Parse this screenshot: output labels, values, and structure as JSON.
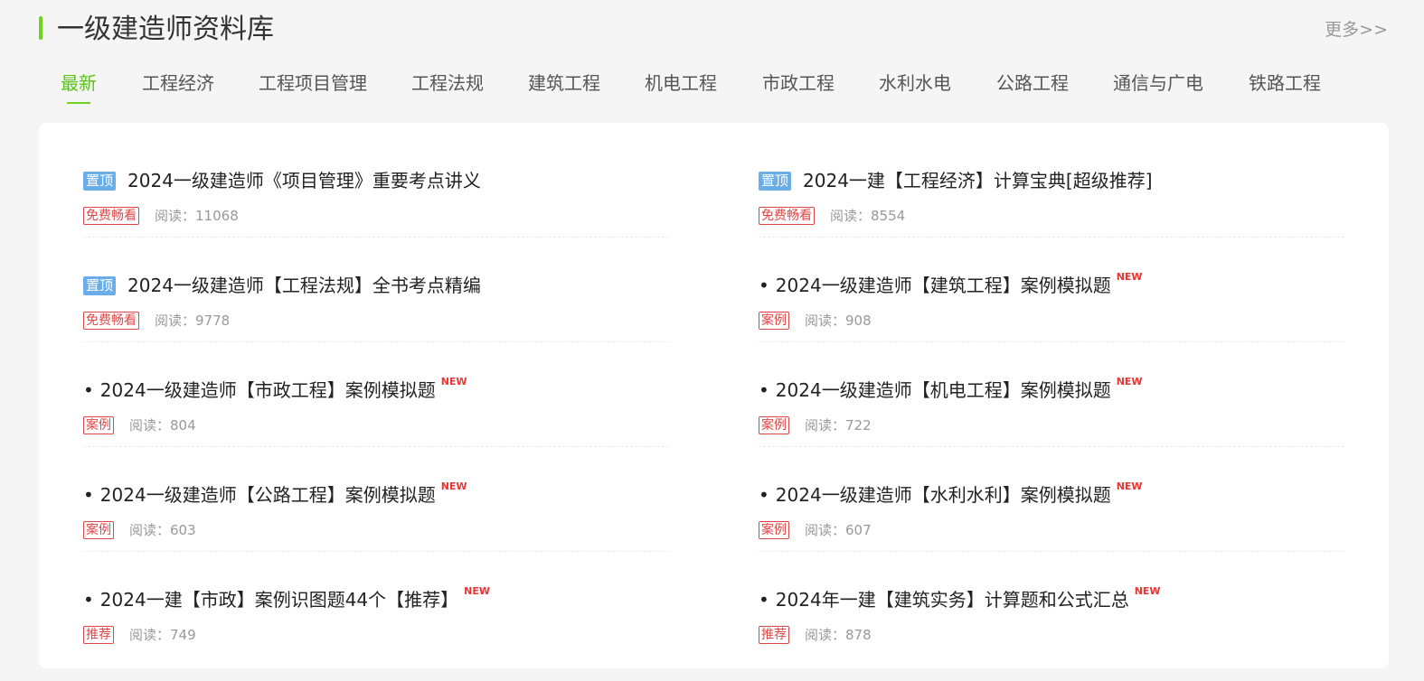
{
  "header": {
    "title": "一级建造师资料库",
    "more": "更多>>"
  },
  "tabs": [
    {
      "label": "最新",
      "active": true
    },
    {
      "label": "工程经济"
    },
    {
      "label": "工程项目管理"
    },
    {
      "label": "工程法规"
    },
    {
      "label": "建筑工程"
    },
    {
      "label": "机电工程"
    },
    {
      "label": "市政工程"
    },
    {
      "label": "水利水电"
    },
    {
      "label": "公路工程"
    },
    {
      "label": "通信与广电"
    },
    {
      "label": "铁路工程"
    }
  ],
  "reads_label": "阅读：",
  "pin_label": "置顶",
  "new_label": "NEW",
  "bullet": "•",
  "items": [
    {
      "pinned": true,
      "title": "2024一级建造师《项目管理》重要考点讲义",
      "tag": "免费畅看",
      "reads": "11068",
      "is_new": false
    },
    {
      "pinned": true,
      "title": "2024一建【工程经济】计算宝典[超级推荐]",
      "tag": "免费畅看",
      "reads": "8554",
      "is_new": false
    },
    {
      "pinned": true,
      "title": "2024一级建造师【工程法规】全书考点精编",
      "tag": "免费畅看",
      "reads": "9778",
      "is_new": false
    },
    {
      "pinned": false,
      "title": "2024一级建造师【建筑工程】案例模拟题",
      "tag": "案例",
      "reads": "908",
      "is_new": true
    },
    {
      "pinned": false,
      "title": "2024一级建造师【市政工程】案例模拟题",
      "tag": "案例",
      "reads": "804",
      "is_new": true
    },
    {
      "pinned": false,
      "title": "2024一级建造师【机电工程】案例模拟题",
      "tag": "案例",
      "reads": "722",
      "is_new": true
    },
    {
      "pinned": false,
      "title": "2024一级建造师【公路工程】案例模拟题",
      "tag": "案例",
      "reads": "603",
      "is_new": true
    },
    {
      "pinned": false,
      "title": "2024一级建造师【水利水利】案例模拟题",
      "tag": "案例",
      "reads": "607",
      "is_new": true
    },
    {
      "pinned": false,
      "title": "2024一建【市政】案例识图题44个【推荐】",
      "tag": "推荐",
      "reads": "749",
      "is_new": true
    },
    {
      "pinned": false,
      "title": "2024年一建【建筑实务】计算题和公式汇总",
      "tag": "推荐",
      "reads": "878",
      "is_new": true
    }
  ]
}
